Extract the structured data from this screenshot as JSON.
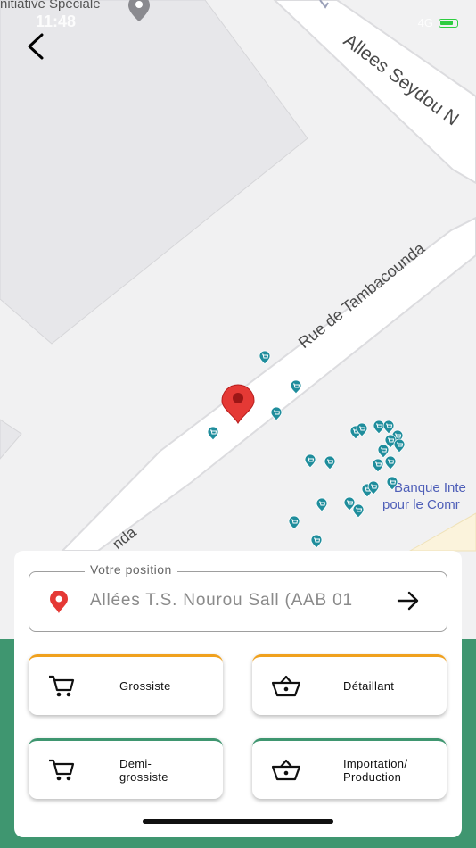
{
  "status": {
    "time": "11:48",
    "network": "4G"
  },
  "map": {
    "poi_top": "nitiative Spéciale",
    "street_1": "Allees Seydou N",
    "street_2": "Rue de Tambacounda",
    "street_3": "nda",
    "bank_line1": "Banque Inte",
    "bank_line2": "pour le Comr"
  },
  "location": {
    "legend": "Votre position",
    "value": "Allées T.S. Nourou Sall (AAB 01"
  },
  "categories": [
    {
      "label": "Grossiste",
      "icon": "cart-icon"
    },
    {
      "label": "Détaillant",
      "icon": "basket-icon"
    },
    {
      "label_line1": "Demi-",
      "label_line2": "grossiste",
      "icon": "cart-icon"
    },
    {
      "label_line1": "Importation/",
      "label_line2": "Production",
      "icon": "basket-icon"
    }
  ],
  "colors": {
    "accent_green": "#3f9670",
    "accent_orange": "#f0a11e",
    "pin_red": "#e53935",
    "shop_marker": "#1f8d9c"
  }
}
